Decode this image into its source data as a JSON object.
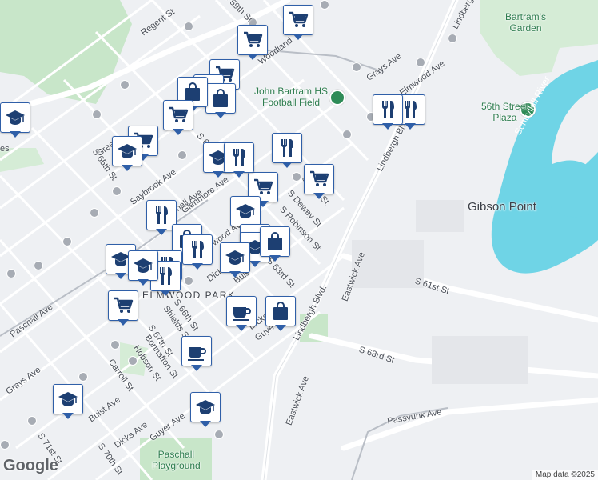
{
  "map": {
    "labels": {
      "regent_st": "Regent St",
      "s_59th_st": "S 59th St",
      "woodland": "Woodland",
      "grays_ave_top": "Grays Ave",
      "elmwood_ave": "Elmwood Ave",
      "lindbergh_blvd_top": "Lindbergh Blvd",
      "lindbergh_blvd_mid": "Lindbergh Blvd.",
      "lindbergh_top_right": "Lindbergh",
      "s_65th_st": "S 65th St",
      "greenway": "Gree",
      "saybrook_ave": "Saybrook Ave",
      "paschall_ave_top": "Paschall Ave",
      "glenmore_ave": "Glenmore Ave",
      "s_62nd_st": "S 62nd St",
      "s_61st_st": "S 61st St",
      "s_dewey_st": "S Dewey St",
      "s_robinson_st": "S Robinson St",
      "s_63rd_st": "S 63rd St",
      "s_66th_st": "S 66th St",
      "s_65th": "S 65th",
      "elmwood_mid": "wood Ave",
      "dicks": "Dicks",
      "buist": "Buis",
      "guyer_mid": "Guye",
      "dicks_mid": "Dicks",
      "shields_st": "Shields St",
      "s_67th_st": "S 67th St",
      "bonnaffon_st": "Bonnaffon St",
      "hobson_st": "Hobson St",
      "carroll_st": "Carroll St",
      "paschall_ave_left": "Paschall Ave",
      "grays_ave_left": "Grays Ave",
      "buist_ave": "Buist Ave",
      "dicks_ave": "Dicks Ave",
      "guyer_ave": "Guyer Ave",
      "s_71st_st": "S 71st St",
      "s_70th_st": "S 70th St",
      "eastwick_ave_mid": "Eastwick Ave",
      "eastwick_ave_low": "Eastwick Ave",
      "s_61st_st_right": "S 61st St",
      "s_63rd_st_right": "S 63rd St",
      "passyunk_ave": "Passyunk Ave",
      "elmwood_park": "ELMWOOD PARK",
      "gibson_point": "Gibson Point",
      "schuylkill_river": "Schuylkill River",
      "bartrams_garden": "Bartram's\nGarden",
      "fifty_sixth_plaza": "56th Street\nPlaza",
      "john_bartram_hs": "John Bartram HS\nFootball Field",
      "paschall_playground": "Paschall\nPlayground",
      "es": "es"
    },
    "markers": [
      {
        "icon": "grocery-cart-icon"
      },
      {
        "icon": "grocery-cart-icon"
      },
      {
        "icon": "grocery-cart-icon"
      },
      {
        "icon": "grocery-cart-icon"
      },
      {
        "icon": "shopping-bag-icon"
      },
      {
        "icon": "shopping-bag-icon"
      },
      {
        "icon": "grocery-cart-icon"
      },
      {
        "icon": "grocery-cart-icon"
      },
      {
        "icon": "school-cap-icon"
      },
      {
        "icon": "restaurant-icon"
      },
      {
        "icon": "restaurant-icon"
      },
      {
        "icon": "grocery-cart-icon"
      },
      {
        "icon": "grocery-cart-icon"
      },
      {
        "icon": "school-cap-icon"
      },
      {
        "icon": "restaurant-icon"
      },
      {
        "icon": "restaurant-icon"
      },
      {
        "icon": "school-cap-icon"
      },
      {
        "icon": "restaurant-icon"
      },
      {
        "icon": "shopping-bag-icon"
      },
      {
        "icon": "restaurant-icon"
      },
      {
        "icon": "school-cap-icon"
      },
      {
        "icon": "school-cap-icon"
      },
      {
        "icon": "restaurant-icon"
      },
      {
        "icon": "school-cap-icon"
      },
      {
        "icon": "shopping-bag-icon"
      },
      {
        "icon": "school-cap-icon"
      },
      {
        "icon": "grocery-cart-icon"
      },
      {
        "icon": "coffee-cup-icon"
      },
      {
        "icon": "shopping-bag-icon"
      },
      {
        "icon": "coffee-cup-icon"
      },
      {
        "icon": "school-cap-icon"
      },
      {
        "icon": "school-cap-icon"
      },
      {
        "icon": "restaurant-icon"
      },
      {
        "icon": "school-cap-icon"
      },
      {
        "icon": "school-cap-icon"
      }
    ],
    "colors": {
      "background": "#eef0f3",
      "park": "#c8e6c9",
      "water": "#6fd4e6",
      "marker_border": "#2f5fa8",
      "icon": "#1d3f72",
      "main_road": "#ffffff",
      "rail": "#b9bec6"
    }
  },
  "footer": {
    "logo": "Google",
    "attribution": "Map data ©2025"
  }
}
